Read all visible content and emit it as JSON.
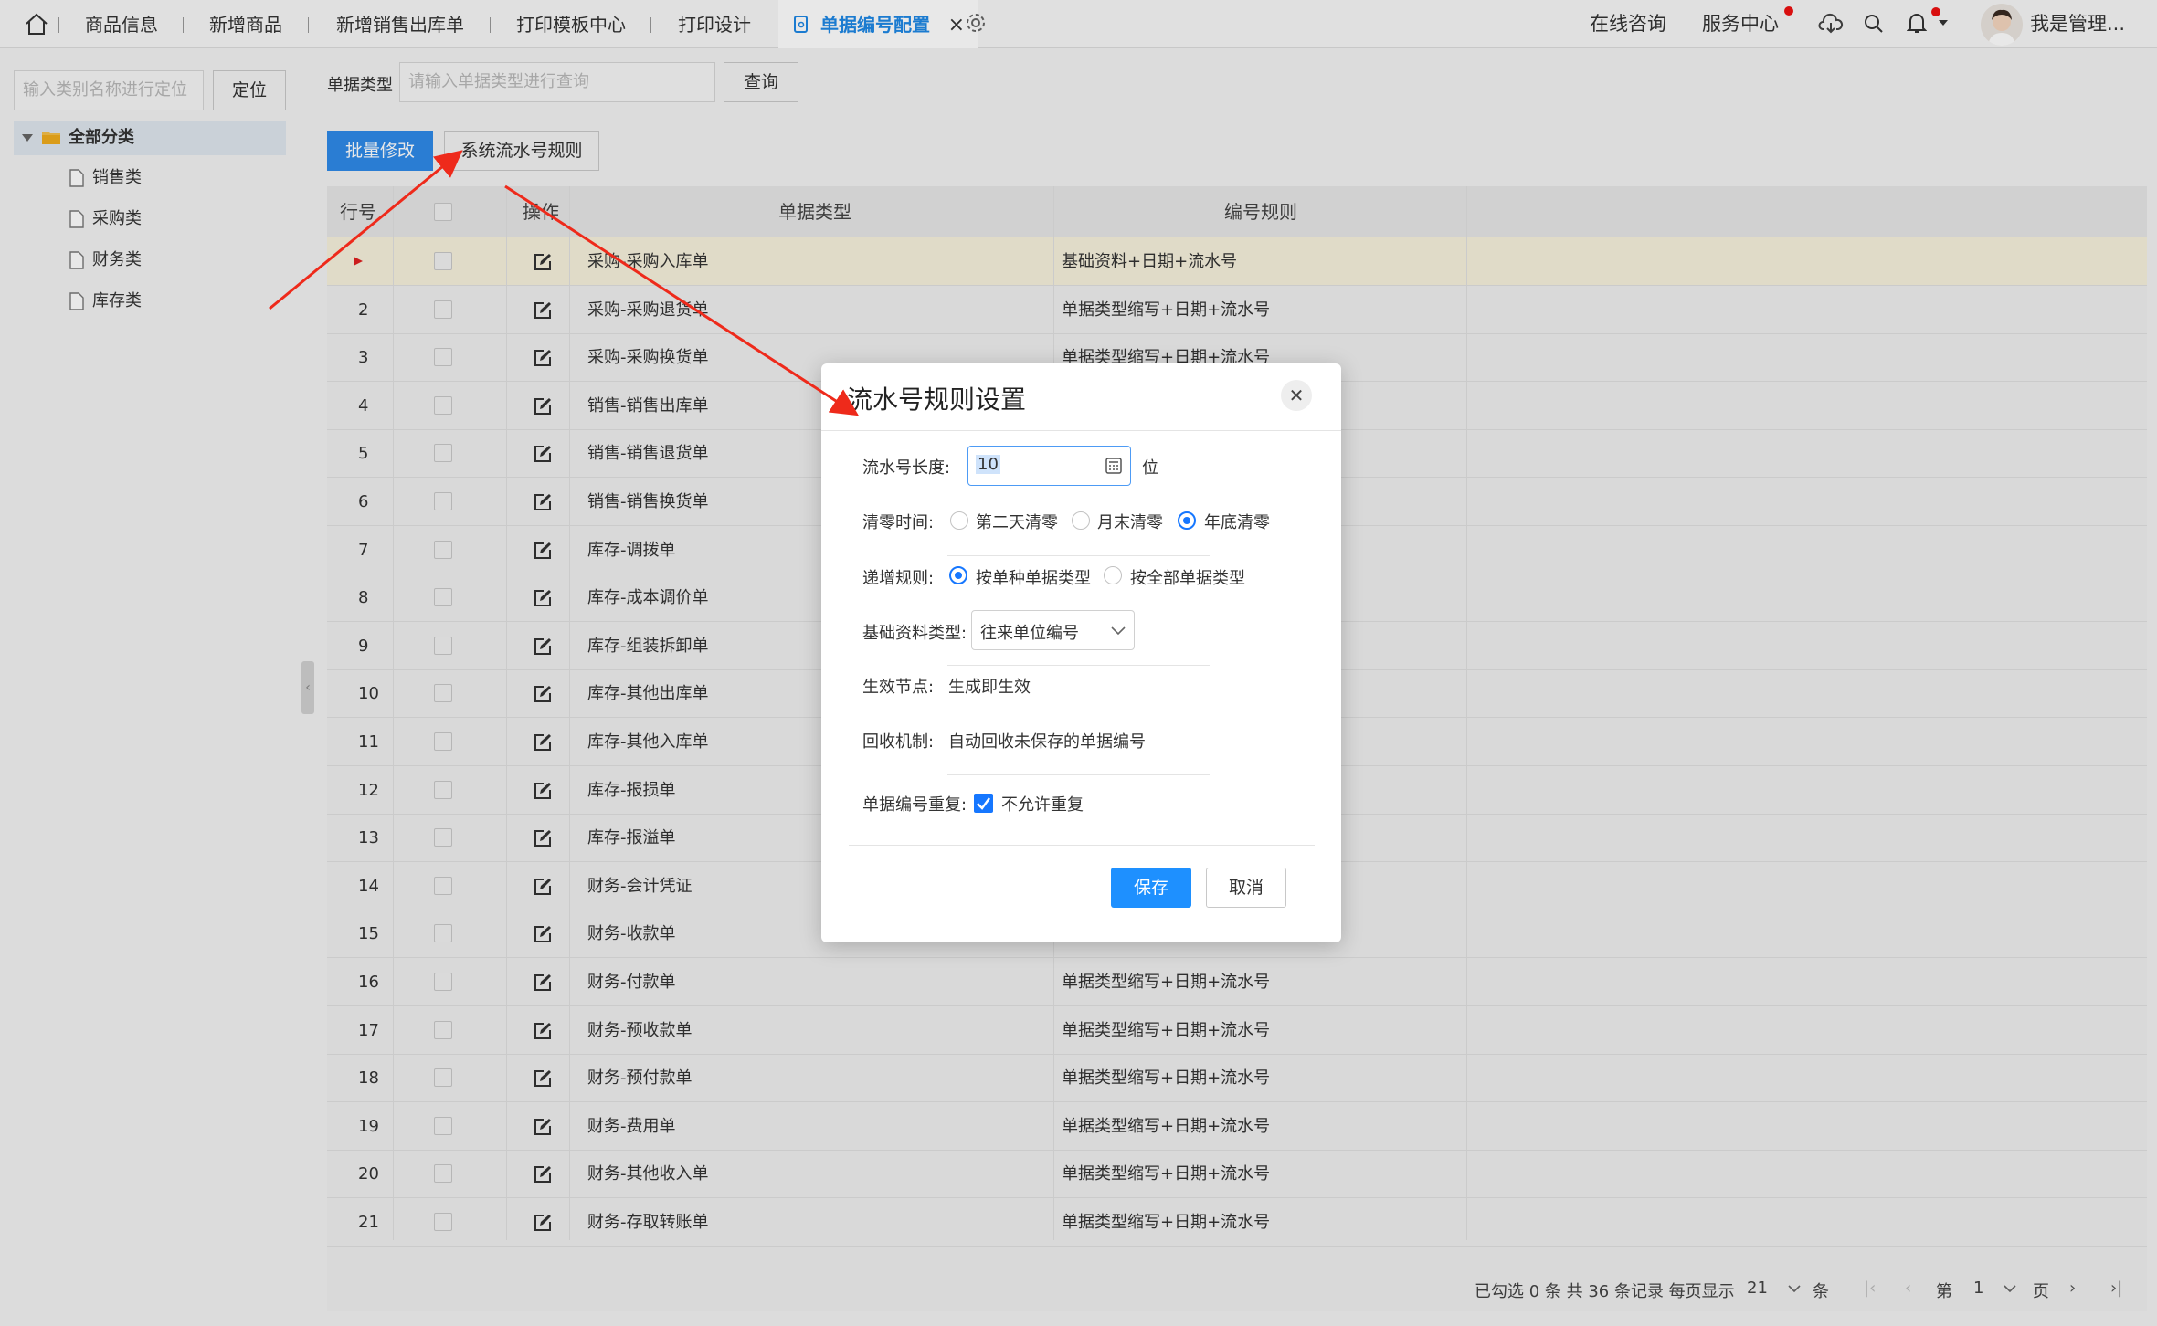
{
  "tabs": [
    "商品信息",
    "新增商品",
    "新增销售出库单",
    "打印模板中心",
    "打印设计"
  ],
  "active_tab": "单据编号配置",
  "top_right": {
    "consult": "在线咨询",
    "service": "服务中心",
    "user": "我是管理..."
  },
  "sidebar": {
    "search_placeholder": "输入类别名称进行定位",
    "locate_button": "定位",
    "root": "全部分类",
    "items": [
      "销售类",
      "采购类",
      "财务类",
      "库存类"
    ]
  },
  "filter": {
    "label": "单据类型",
    "placeholder": "请输入单据类型进行查询",
    "query_button": "查询"
  },
  "toolbar": {
    "batch_edit": "批量修改",
    "serial_rule": "系统流水号规则"
  },
  "table": {
    "headers": {
      "row": "行号",
      "action": "操作",
      "type": "单据类型",
      "rule": "编号规则"
    },
    "rows": [
      {
        "no": "",
        "type": "采购-采购入库单",
        "rule": "基础资料+日期+流水号"
      },
      {
        "no": "2",
        "type": "采购-采购退货单",
        "rule": "单据类型缩写+日期+流水号"
      },
      {
        "no": "3",
        "type": "采购-采购换货单",
        "rule": "单据类型缩写+日期+流水号"
      },
      {
        "no": "4",
        "type": "销售-销售出库单",
        "rule": ""
      },
      {
        "no": "5",
        "type": "销售-销售退货单",
        "rule": ""
      },
      {
        "no": "6",
        "type": "销售-销售换货单",
        "rule": ""
      },
      {
        "no": "7",
        "type": "库存-调拨单",
        "rule": ""
      },
      {
        "no": "8",
        "type": "库存-成本调价单",
        "rule": ""
      },
      {
        "no": "9",
        "type": "库存-组装拆卸单",
        "rule": ""
      },
      {
        "no": "10",
        "type": "库存-其他出库单",
        "rule": ""
      },
      {
        "no": "11",
        "type": "库存-其他入库单",
        "rule": ""
      },
      {
        "no": "12",
        "type": "库存-报损单",
        "rule": ""
      },
      {
        "no": "13",
        "type": "库存-报溢单",
        "rule": ""
      },
      {
        "no": "14",
        "type": "财务-会计凭证",
        "rule": ""
      },
      {
        "no": "15",
        "type": "财务-收款单",
        "rule": ""
      },
      {
        "no": "16",
        "type": "财务-付款单",
        "rule": "单据类型缩写+日期+流水号"
      },
      {
        "no": "17",
        "type": "财务-预收款单",
        "rule": "单据类型缩写+日期+流水号"
      },
      {
        "no": "18",
        "type": "财务-预付款单",
        "rule": "单据类型缩写+日期+流水号"
      },
      {
        "no": "19",
        "type": "财务-费用单",
        "rule": "单据类型缩写+日期+流水号"
      },
      {
        "no": "20",
        "type": "财务-其他收入单",
        "rule": "单据类型缩写+日期+流水号"
      },
      {
        "no": "21",
        "type": "财务-存取转账单",
        "rule": "单据类型缩写+日期+流水号"
      }
    ]
  },
  "pager": {
    "summary": "已勾选 0 条  共 36 条记录  每页显示",
    "page_size": "21",
    "unit": "条",
    "page_label": "第",
    "page": "1",
    "page_unit": "页"
  },
  "modal": {
    "title": "流水号规则设置",
    "length_label": "流水号长度:",
    "length_value": "10",
    "length_unit": "位",
    "reset_label": "清零时间:",
    "reset_options": [
      "第二天清零",
      "月末清零",
      "年底清零"
    ],
    "reset_selected": 2,
    "increment_label": "递增规则:",
    "increment_options": [
      "按单种单据类型",
      "按全部单据类型"
    ],
    "increment_selected": 0,
    "base_label": "基础资料类型:",
    "base_value": "往来单位编号",
    "effect_label": "生效节点:",
    "effect_value": "生成即生效",
    "recycle_label": "回收机制:",
    "recycle_value": "自动回收未保存的单据编号",
    "dup_label": "单据编号重复:",
    "dup_value": "不允许重复",
    "save": "保存",
    "cancel": "取消"
  },
  "colors": {
    "accent": "#1e88e5",
    "primary_button": "#1e90ff",
    "arrow": "#ee2a1b",
    "highlight_row": "#f7f1dc"
  }
}
